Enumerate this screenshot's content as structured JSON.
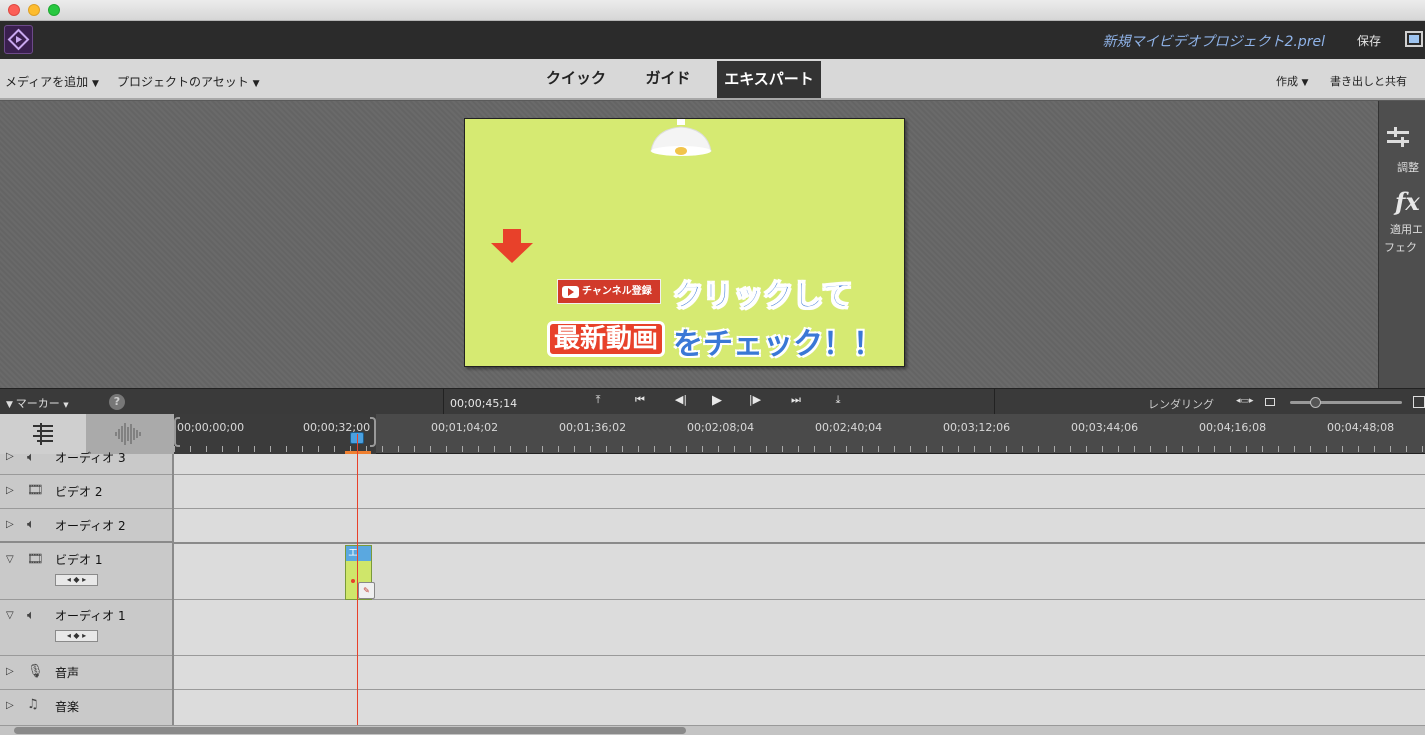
{
  "window": {
    "project_title": "新規マイビデオプロジェクト2.prel",
    "save_label": "保存"
  },
  "modebar": {
    "add_media": "メディアを追加",
    "project_assets": "プロジェクトのアセット",
    "tabs": [
      {
        "label": "クイック",
        "active": false
      },
      {
        "label": "ガイド",
        "active": false
      },
      {
        "label": "エキスパート",
        "active": true
      }
    ],
    "create": "作成",
    "export_share": "書き出しと共有"
  },
  "side_panel": {
    "adjust_label": "調整",
    "effects_label_1": "適用エ",
    "effects_label_2": "フェク"
  },
  "preview": {
    "channel_badge": "チャンネル登録",
    "line1": "クリックして",
    "line2_highlight": "最新動画",
    "line2_rest": "をチェック！！",
    "background_color": "#d6ea72"
  },
  "transport": {
    "marker_label": "マーカー",
    "timecode": "00;00;45;14",
    "rendering_label": "レンダリング"
  },
  "ruler": {
    "timecodes": [
      "00;00;00;00",
      "00;00;32;00",
      "00;01;04;02",
      "00;01;36;02",
      "00;02;08;04",
      "00;02;40;04",
      "00;03;12;06",
      "00;03;44;06",
      "00;04;16;08",
      "00;04;48;08"
    ]
  },
  "tracks": [
    {
      "label": "オーディオ 3",
      "type": "audio",
      "expanded": false
    },
    {
      "label": "ビデオ 2",
      "type": "video",
      "expanded": false
    },
    {
      "label": "オーディオ 2",
      "type": "audio",
      "expanded": false
    },
    {
      "label": "ビデオ 1",
      "type": "video",
      "expanded": true
    },
    {
      "label": "オーディオ 1",
      "type": "audio",
      "expanded": true
    },
    {
      "label": "音声",
      "type": "voice",
      "expanded": false
    },
    {
      "label": "音楽",
      "type": "music",
      "expanded": false
    }
  ],
  "clip": {
    "title": "エ"
  },
  "colors": {
    "playhead": "#e8412a",
    "accent_blue": "#4aa0e0",
    "title_blue": "#8fb3e8"
  }
}
